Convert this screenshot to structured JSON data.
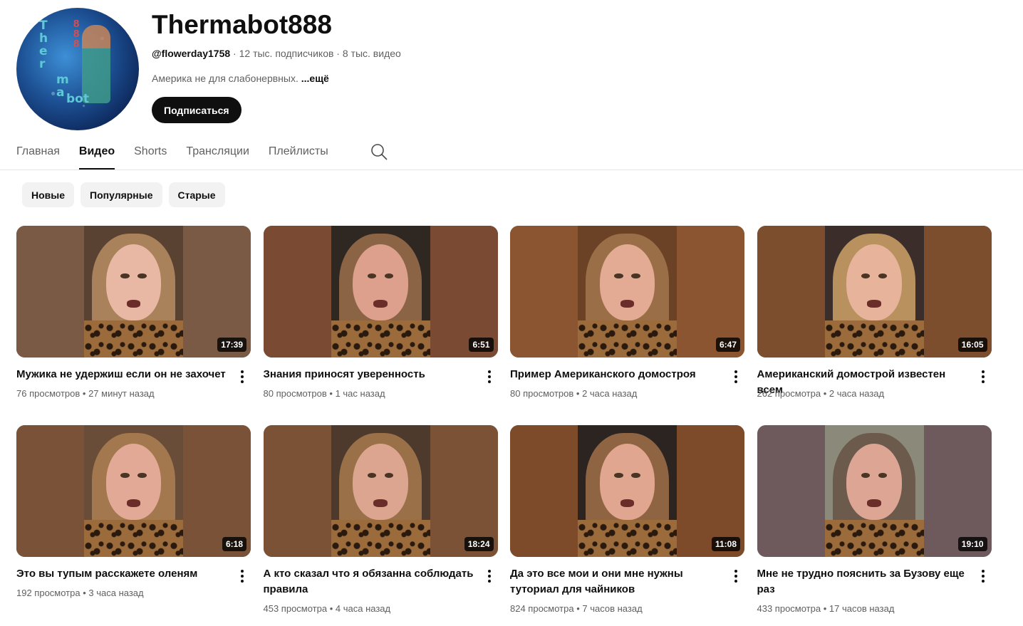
{
  "channel": {
    "name": "Thermabot888",
    "handle": "@flowerday1758",
    "sep1": " · ",
    "subscribers": "12 тыс. подписчиков",
    "sep2": " · ",
    "videos_count": "8 тыс. видео",
    "description": "Америка не для слабонервных. ",
    "more_label": "...ещё",
    "subscribe_label": "Подписаться",
    "avatar_letters_a": "T\nh\ne\nr",
    "avatar_letters_b": "m\na",
    "avatar_letters_c": "bot",
    "avatar_digits": "8\n8\n8"
  },
  "tabs": [
    {
      "label": "Главная",
      "active": false
    },
    {
      "label": "Видео",
      "active": true
    },
    {
      "label": "Shorts",
      "active": false
    },
    {
      "label": "Трансляции",
      "active": false
    },
    {
      "label": "Плейлисты",
      "active": false
    }
  ],
  "chips": [
    "Новые",
    "Популярные",
    "Старые"
  ],
  "icons": {
    "search": "search-icon",
    "menu": "more-vert-icon"
  },
  "colors": {
    "accent": "#0f0f0f",
    "chip_bg": "#f2f2f2",
    "meta_text": "#606060",
    "thumb_side": "#7a4f35"
  },
  "videos": [
    {
      "title": "Мужика не удержиш если он не захочет",
      "views": "76 просмотров",
      "age": "27 минут назад",
      "duration": "17:39",
      "side": "#7b5a45",
      "bg": "#5a4232",
      "hair": "#a9815a",
      "skin": "#e8b8a4"
    },
    {
      "title": "Знания приносят уверенность",
      "views": "80 просмотров",
      "age": "1 час назад",
      "duration": "6:51",
      "side": "#7a4a32",
      "bg": "#2f2722",
      "hair": "#8b6446",
      "skin": "#dca08c"
    },
    {
      "title": "Пример Американского домостроя",
      "views": "80 просмотров",
      "age": "2 часа назад",
      "duration": "6:47",
      "side": "#8a5530",
      "bg": "#6c4226",
      "hair": "#9a6e47",
      "skin": "#e3ab94"
    },
    {
      "title": "Американский домострой известен всем",
      "views": "262 просмотра",
      "age": "2 часа назад",
      "duration": "16:05",
      "side": "#7c4e2e",
      "bg": "#3b2e2a",
      "hair": "#b8915f",
      "skin": "#e7b39b"
    },
    {
      "title": "Это вы тупым расскажете оленям",
      "views": "192 просмотра",
      "age": "3 часа назад",
      "duration": "6:18",
      "side": "#7a5238",
      "bg": "#6a4d38",
      "hair": "#a3784f",
      "skin": "#e2aa96"
    },
    {
      "title": "А кто сказал что я обязанна соблюдать правила",
      "views": "453 просмотра",
      "age": "4 часа назад",
      "duration": "18:24",
      "side": "#7b5236",
      "bg": "#4d3a2c",
      "hair": "#9a7049",
      "skin": "#dca590"
    },
    {
      "title": "Да это все мои и они мне нужны туториал для чайников",
      "views": "824 просмотра",
      "age": "7 часов назад",
      "duration": "11:08",
      "side": "#7d4a2a",
      "bg": "#2c2420",
      "hair": "#8e6443",
      "skin": "#e0a690"
    },
    {
      "title": "Мне не трудно пояснить за Бузову еще раз",
      "views": "433 просмотра",
      "age": "17 часов назад",
      "duration": "19:10",
      "side": "#6e5a5c",
      "bg": "#8b8a7a",
      "hair": "#6c5a4c",
      "skin": "#dca594"
    }
  ]
}
